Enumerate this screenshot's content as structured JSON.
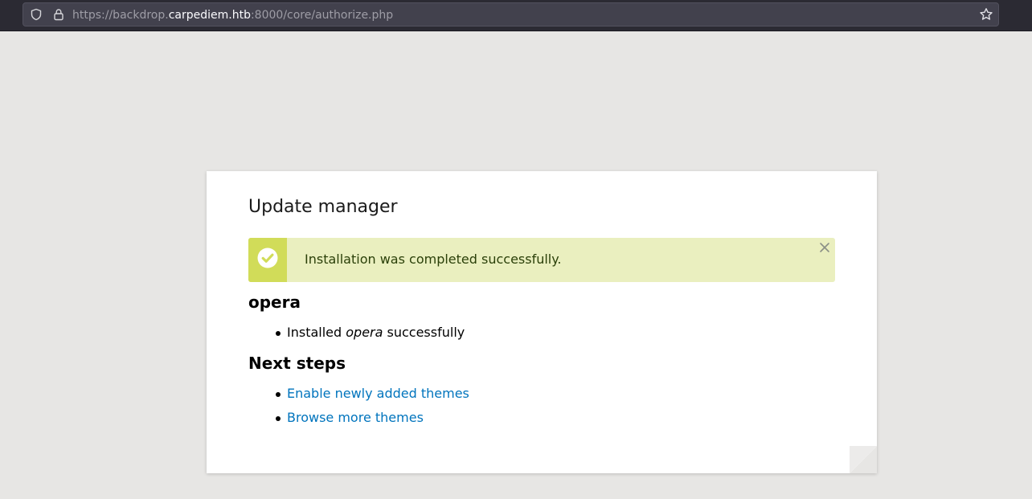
{
  "browser": {
    "url_prefix": "https://backdrop.",
    "url_host": "carpediem.htb",
    "url_suffix": ":8000/core/authorize.php"
  },
  "page": {
    "title": "Update manager",
    "message": {
      "text": "Installation was completed successfully.",
      "status": "success",
      "icon": "check-circle-icon"
    },
    "project_heading": "opera",
    "installed_item": {
      "prefix": "Installed ",
      "project": "opera",
      "suffix": " successfully"
    },
    "next_steps_heading": "Next steps",
    "next_steps": [
      {
        "label": "Enable newly added themes"
      },
      {
        "label": "Browse more themes"
      }
    ]
  },
  "colors": {
    "page_background": "#e7e6e4",
    "success_bar": "#d1dc59",
    "success_background": "#eaefbf",
    "success_text": "#2b4009",
    "link": "#0074bd"
  }
}
